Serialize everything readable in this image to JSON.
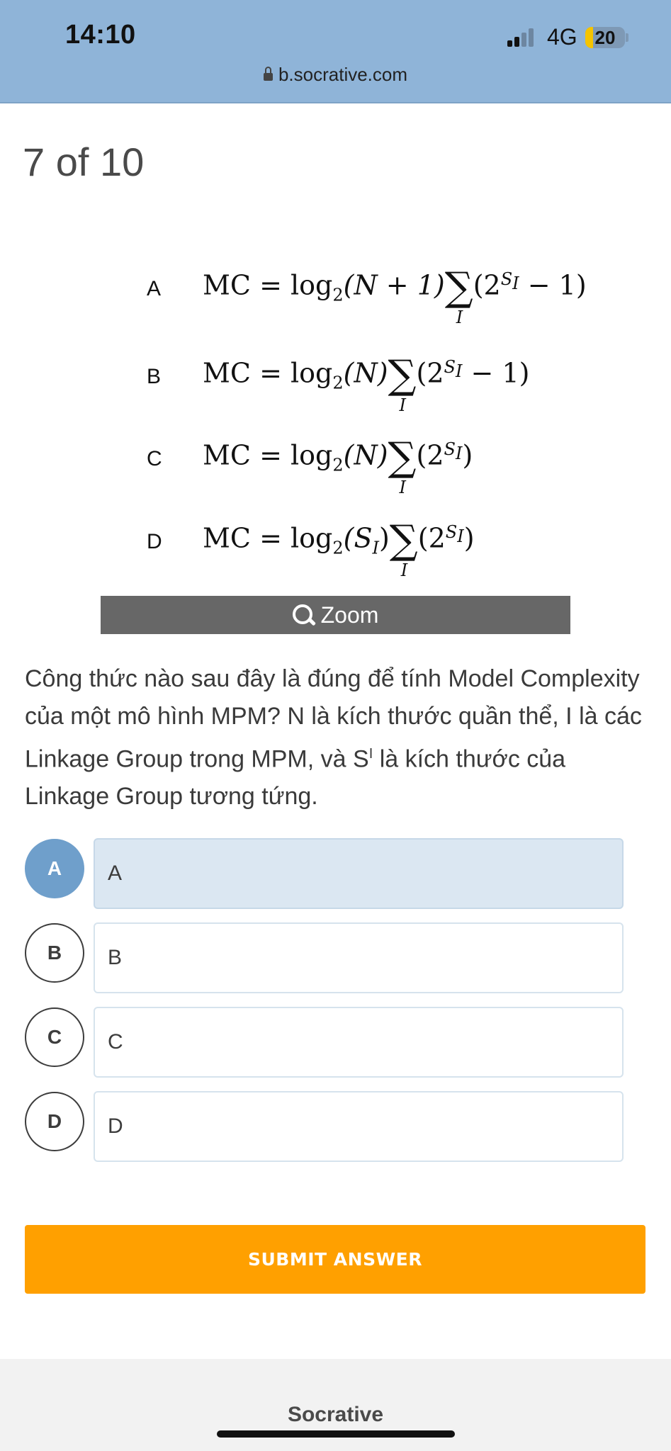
{
  "status_bar": {
    "time": "14:10",
    "network": "4G",
    "battery": "20",
    "battery_level": 0.2
  },
  "browser": {
    "url": "b.socrative.com"
  },
  "quiz": {
    "progress": "7 of 10"
  },
  "formula_image": {
    "options": [
      {
        "letter": "A",
        "lhs": "MC = log",
        "base": "2",
        "arg": "(N + 1)",
        "sum_index": "I",
        "term_open": "(2",
        "exp": "S",
        "exp_sub": "I",
        "term_close": " − 1)"
      },
      {
        "letter": "B",
        "lhs": "MC = log",
        "base": "2",
        "arg": "(N)",
        "sum_index": "I",
        "term_open": "(2",
        "exp": "S",
        "exp_sub": "I",
        "term_close": " − 1)"
      },
      {
        "letter": "C",
        "lhs": "MC = log",
        "base": "2",
        "arg": "(N)",
        "sum_index": "I",
        "term_open": "(2",
        "exp": "S",
        "exp_sub": "I",
        "term_close": ")"
      },
      {
        "letter": "D",
        "lhs": "MC = log",
        "base": "2",
        "arg": "(S",
        "arg_sub": "I",
        "arg_close": ")",
        "sum_index": "I",
        "term_open": "(2",
        "exp": "S",
        "exp_sub": "I",
        "term_close": ")"
      }
    ],
    "sigma": "∑",
    "zoom_label": "Zoom"
  },
  "question": {
    "text_part1": "Công thức nào sau đây là đúng để tính Model Complexity của một mô hình MPM? N là kích thước quần thể, I là các Linkage Group trong MPM, và S",
    "superscript": "I",
    "text_part2": " là kích thước của Linkage Group tương tứng."
  },
  "choices": [
    {
      "letter": "A",
      "label": "A",
      "selected": true
    },
    {
      "letter": "B",
      "label": "B",
      "selected": false
    },
    {
      "letter": "C",
      "label": "C",
      "selected": false
    },
    {
      "letter": "D",
      "label": "D",
      "selected": false
    }
  ],
  "submit_label": "SUBMIT ANSWER",
  "footer": {
    "brand": "Socrative"
  },
  "colors": {
    "header": "#8fb4d8",
    "selected": "#6f9fcb",
    "selected_box": "#dbe7f2",
    "submit": "#ffa000",
    "zoom_bar": "#676767"
  }
}
